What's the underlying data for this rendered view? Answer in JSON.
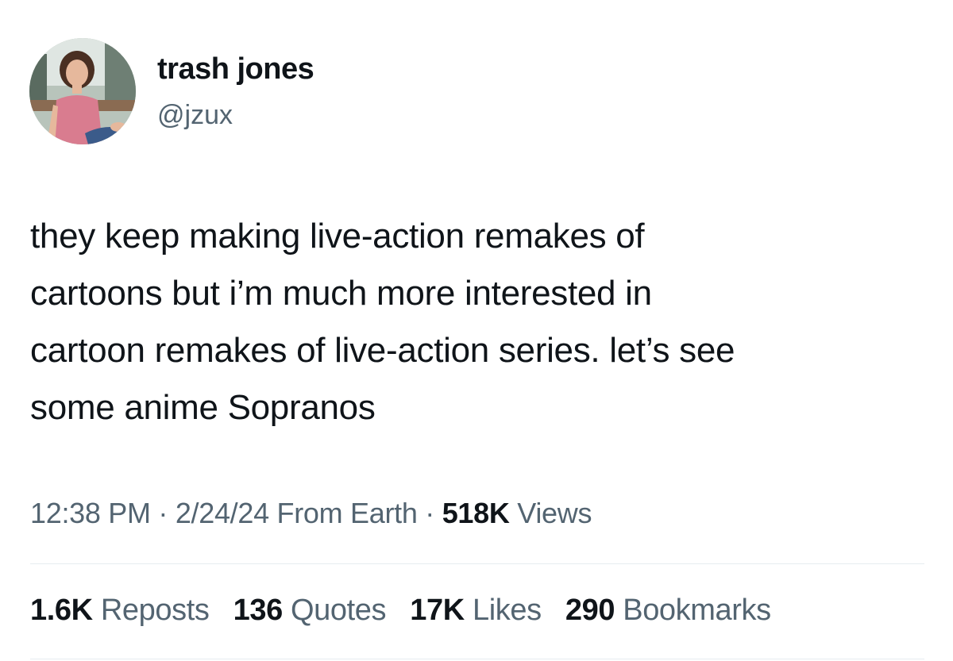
{
  "author": {
    "display_name": "trash jones",
    "handle": "@jzux"
  },
  "tweet": {
    "text_lines": [
      "they keep making live-action remakes of",
      "cartoons but i’m much more interested in",
      "cartoon remakes of live-action series. let’s see",
      "some anime Sopranos"
    ]
  },
  "meta": {
    "time": "12:38 PM",
    "separator": "·",
    "date": "2/24/24",
    "source": "From Earth",
    "views_count": "518K",
    "views_label": "Views"
  },
  "stats": {
    "reposts_count": "1.6K",
    "reposts_label": "Reposts",
    "quotes_count": "136",
    "quotes_label": "Quotes",
    "likes_count": "17K",
    "likes_label": "Likes",
    "bookmarks_count": "290",
    "bookmarks_label": "Bookmarks"
  },
  "colors": {
    "primary_text": "#0f1419",
    "secondary_text": "#536471",
    "divider": "#e6ecf0"
  }
}
